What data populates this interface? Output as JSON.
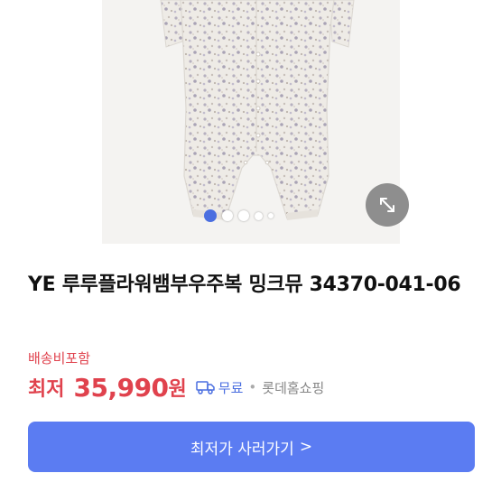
{
  "product": {
    "title": "YE 루루플라워뱀부우주복 밍크뮤 34370-041-06",
    "image_count": 5,
    "active_image": 1
  },
  "pricing": {
    "shipping_note": "배송비포함",
    "lowest_label": "최저",
    "price": "35,990",
    "currency_unit": "원",
    "delivery_label": "무료",
    "separator": "•",
    "store_name": "롯데홈쇼핑"
  },
  "actions": {
    "buy_label": "최저가 사러가기",
    "buy_chevron": ">"
  },
  "icons": {
    "expand": "expand-arrows-icon",
    "delivery": "truck-icon",
    "chevron": "chevron-right-icon"
  },
  "colors": {
    "accent": "#5b7cf2",
    "price_red": "#e0424d",
    "active_dot": "#4a6ee0",
    "link_blue": "#4a6ee0"
  }
}
